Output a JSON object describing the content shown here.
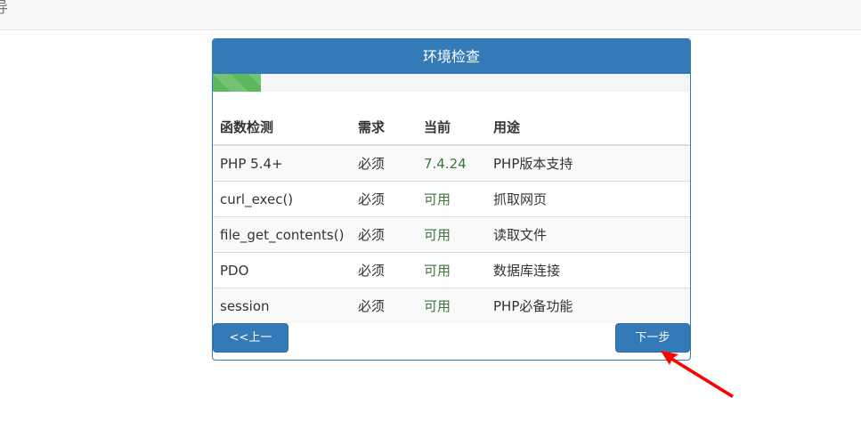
{
  "topbar": {
    "title": "导"
  },
  "panel": {
    "title": "环境检查",
    "progress_percent": 10,
    "columns": [
      "函数检测",
      "需求",
      "当前",
      "用途"
    ],
    "rows": [
      {
        "name": "PHP 5.4+",
        "requirement": "必须",
        "current": "7.4.24",
        "purpose": "PHP版本支持"
      },
      {
        "name": "curl_exec()",
        "requirement": "必须",
        "current": "可用",
        "purpose": "抓取网页"
      },
      {
        "name": "file_get_contents()",
        "requirement": "必须",
        "current": "可用",
        "purpose": "读取文件"
      },
      {
        "name": "PDO",
        "requirement": "必须",
        "current": "可用",
        "purpose": "数据库连接"
      },
      {
        "name": "session",
        "requirement": "必须",
        "current": "可用",
        "purpose": "PHP必备功能"
      }
    ],
    "prev_label": "<<上一步",
    "next_label": "下一步>>"
  },
  "annotation": {
    "arrow_color": "#ff0000"
  }
}
